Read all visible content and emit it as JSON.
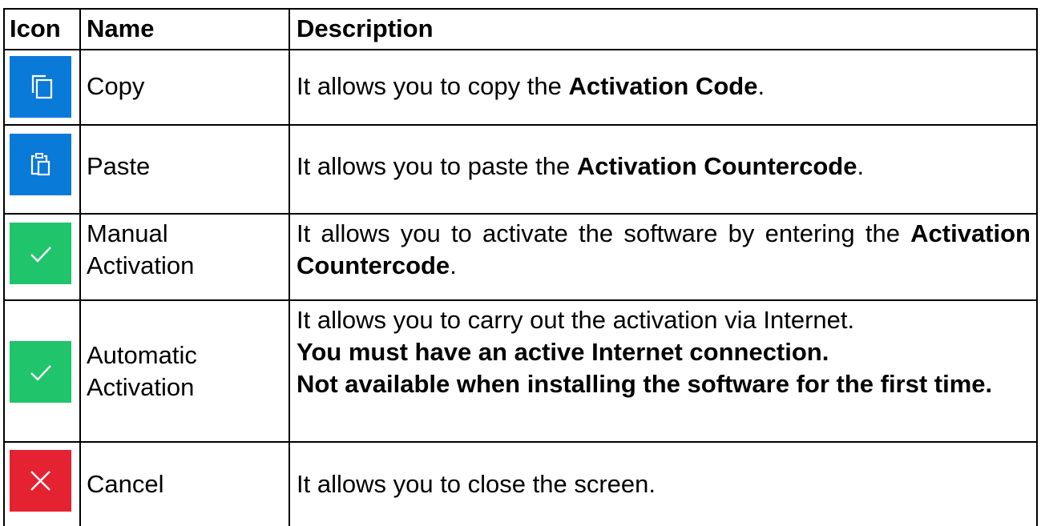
{
  "header": {
    "icon": "Icon",
    "name": "Name",
    "description": "Description"
  },
  "colors": {
    "blue": "#0a7ad9",
    "green": "#1fc46b",
    "red": "#e52231",
    "border": "#000000"
  },
  "rows": [
    {
      "icon": "copy-icon",
      "name": "Copy",
      "desc_pre": "It allows you to copy the ",
      "desc_bold": "Activation Code",
      "desc_post": "."
    },
    {
      "icon": "paste-icon",
      "name": "Paste",
      "desc_pre": "It allows you to paste the ",
      "desc_bold": "Activation Countercode",
      "desc_post": "."
    },
    {
      "icon": "checkmark-icon",
      "name_line1": "Manual",
      "name_line2": "Activation",
      "desc_pre": "It allows you to activate the software by entering the ",
      "desc_bold": "Activation Countercode",
      "desc_post": "."
    },
    {
      "icon": "checkmark-icon",
      "name_line1": "Automatic",
      "name_line2": "Activation",
      "desc_line1": "It allows you to carry out the activation via Internet.",
      "desc_bold1": "You must have an active Internet connection.",
      "desc_bold2": "Not available when installing the software for the first time."
    },
    {
      "icon": "close-icon",
      "name": "Cancel",
      "desc": "It allows you to close the screen."
    }
  ]
}
